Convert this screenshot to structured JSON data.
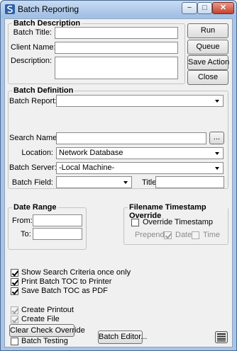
{
  "window": {
    "title": "Batch Reporting",
    "min_glyph": "−",
    "max_glyph": "□",
    "close_glyph": "✕"
  },
  "batch_description": {
    "title": "Batch Description",
    "batch_title_label": "Batch Title:",
    "batch_title_value": "",
    "client_name_label": "Client Name:",
    "client_name_value": "",
    "description_label": "Description:",
    "description_value": ""
  },
  "buttons": {
    "run": "Run",
    "queue": "Queue",
    "save_action": "Save Action",
    "close": "Close",
    "ellipsis": "...",
    "clear_check_override": "Clear Check Override",
    "batch_editor": "Batch Editor..."
  },
  "batch_definition": {
    "title": "Batch Definition",
    "batch_report_label": "Batch Report:",
    "batch_report_value": "",
    "search_name_label": "Search Name:",
    "search_name_value": "",
    "location_label": "Location:",
    "location_value": "Network Database",
    "batch_server_label": "Batch Server:",
    "batch_server_value": "-Local Machine-",
    "batch_field_label": "Batch Field:",
    "batch_field_value": "",
    "title_label": "Title:",
    "title_value": ""
  },
  "date_range": {
    "title": "Date Range",
    "from_label": "From:",
    "from_value": "",
    "to_label": "To:",
    "to_value": ""
  },
  "timestamp_override": {
    "title": "Filename Timestamp Override",
    "override_label": "Override Timestamp",
    "override_checked": false,
    "prepend_label": "Prepend:",
    "date_label": "Date",
    "date_checked": true,
    "time_label": "Time",
    "time_checked": false
  },
  "options": [
    {
      "label": "Show Search Criteria once only",
      "checked": true,
      "enabled": true
    },
    {
      "label": "Print Batch TOC to Printer",
      "checked": true,
      "enabled": true
    },
    {
      "label": "Save Batch TOC as PDF",
      "checked": true,
      "enabled": true
    },
    {
      "label": "Create Printout",
      "checked": true,
      "enabled": false
    },
    {
      "label": "Create File",
      "checked": true,
      "enabled": false
    }
  ],
  "batch_testing": {
    "label": "Batch Testing",
    "checked": false
  }
}
